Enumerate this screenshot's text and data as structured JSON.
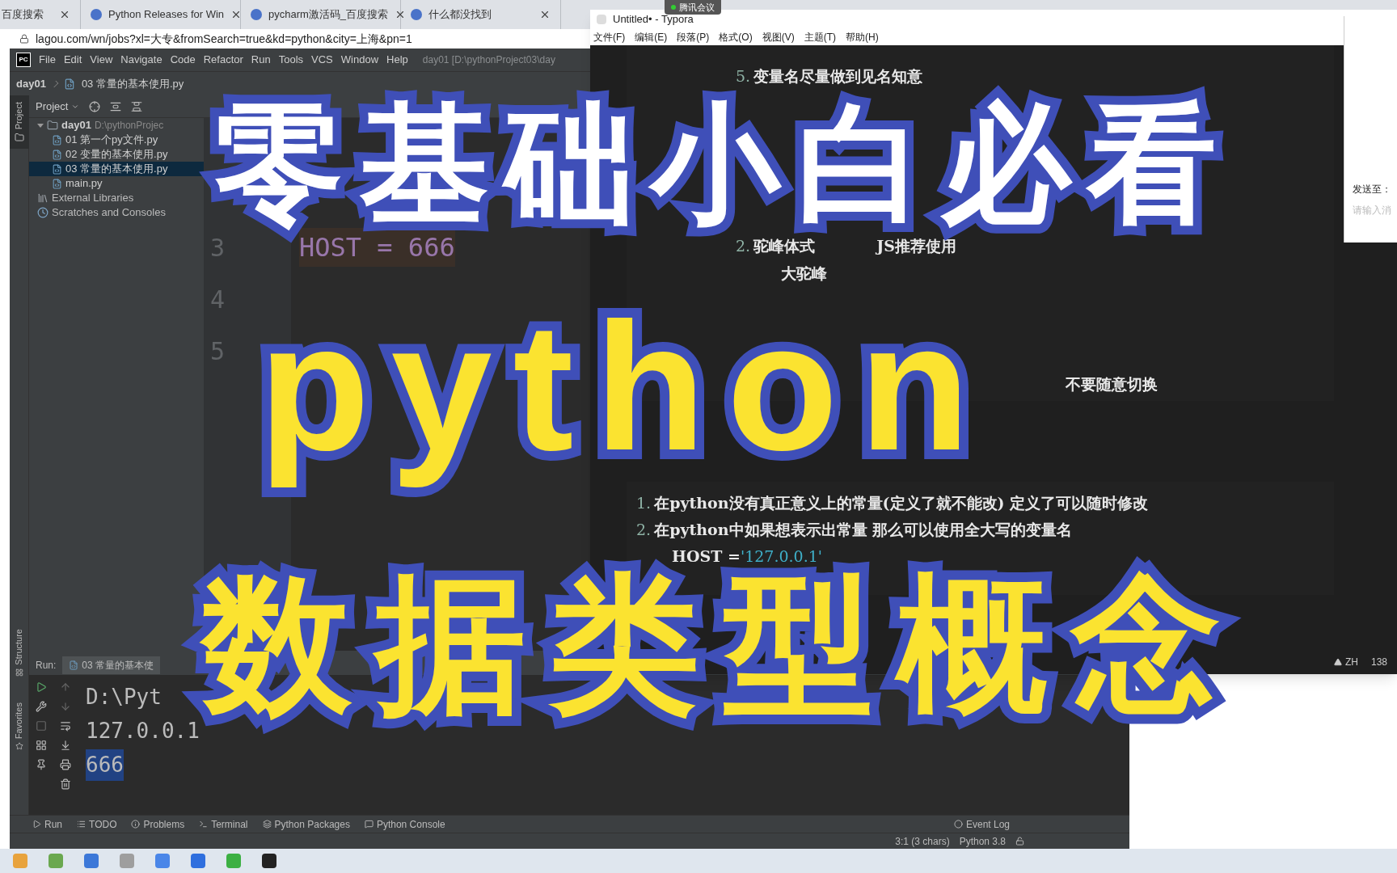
{
  "browser": {
    "tabs": [
      {
        "title": "百度搜索"
      },
      {
        "title": "Python Releases for Win"
      },
      {
        "title": "pycharm激活码_百度搜索"
      },
      {
        "title": "什么都没找到"
      }
    ],
    "url": "lagou.com/wn/jobs?xl=大专&fromSearch=true&kd=python&city=上海&pn=1"
  },
  "meeting_badge": "腾讯会议",
  "pycharm": {
    "logo": "PC",
    "menu": [
      "File",
      "Edit",
      "View",
      "Navigate",
      "Code",
      "Refactor",
      "Run",
      "Tools",
      "VCS",
      "Window",
      "Help"
    ],
    "title": "day01 [D:\\pythonProject03\\day",
    "breadcrumb": [
      "day01",
      "03 常量的基本使用.py"
    ],
    "side_tabs": [
      {
        "label": "Project",
        "selected": true
      }
    ],
    "project_header": "Project",
    "tree": [
      {
        "label": "day01",
        "path": "D:\\pythonProjec",
        "expanded": true,
        "children": [
          {
            "label": "01 第一个py文件.py",
            "selected": false
          },
          {
            "label": "02 变量的基本使用.py",
            "selected": false
          },
          {
            "label": "03 常量的基本使用.py",
            "selected": true
          },
          {
            "label": "main.py",
            "selected": false
          }
        ]
      },
      {
        "label": "External Libraries",
        "kind": "library"
      },
      {
        "label": "Scratches and Consoles",
        "kind": "scratch"
      }
    ],
    "editor_lines": [
      {
        "number": "3",
        "code": "HOST = 666"
      },
      {
        "number": "4"
      },
      {
        "number": "5"
      }
    ],
    "run": {
      "label": "Run:",
      "tab": "03 常量的基本使",
      "output": [
        {
          "text": "D:\\Pyt",
          "selected": false
        },
        {
          "text": "127.0.0.1",
          "selected": false
        },
        {
          "text": "666",
          "selected": true
        }
      ]
    },
    "left_tabs": [
      {
        "label": "Structure",
        "selected": false
      },
      {
        "label": "Favorites",
        "selected": false
      }
    ],
    "tool_tabs": [
      "Run",
      "TODO",
      "Problems",
      "Terminal",
      "Python Packages",
      "Python Console"
    ],
    "event_log": "Event Log",
    "status": {
      "position": "3:1 (3 chars)",
      "interpreter": "Python 3.8"
    }
  },
  "typora": {
    "title": "Untitled• - Typora",
    "menu": [
      "文件(F)",
      "编辑(E)",
      "段落(P)",
      "格式(O)",
      "视图(V)",
      "主题(T)",
      "帮助(H)"
    ],
    "upper_lines": [
      {
        "parts": [
          {
            "text": "5.",
            "kind": "marker"
          },
          {
            "text": "变量名尽量做到见名知意",
            "kind": "text"
          }
        ]
      },
      {
        "parts": [
          {
            "text": "2.",
            "kind": "marker"
          },
          {
            "text": "驼峰体式",
            "kind": "text"
          },
          {
            "text": "JS推荐使用",
            "kind": "text"
          }
        ]
      },
      {
        "parts": [
          {
            "text": "大驼峰",
            "kind": "text"
          }
        ]
      },
      {
        "parts": [
          {
            "text": "不要随意切换",
            "kind": "text"
          }
        ]
      }
    ],
    "lower_lines": [
      {
        "parts": [
          {
            "text": "1.",
            "kind": "marker"
          },
          {
            "text": "在python没有真正意义上的常量(定义了就不能改) 定义了可以随时修改",
            "kind": "text"
          }
        ]
      },
      {
        "parts": [
          {
            "text": "2.",
            "kind": "marker"
          },
          {
            "text": "在python中如果想表示出常量 那么可以使用全大写的变量名",
            "kind": "text"
          }
        ]
      },
      {
        "parts": [
          {
            "text": "HOST = ",
            "kind": "text"
          },
          {
            "text": "'127.0.0.1'",
            "kind": "string"
          }
        ]
      }
    ],
    "status": {
      "language": "ZH",
      "count": "138"
    }
  },
  "side_panel": {
    "label": "发送至：",
    "placeholder": "请输入消"
  },
  "overlay": {
    "line1": "零基础小白必看",
    "line2": "python",
    "line3": "数据类型概念"
  }
}
